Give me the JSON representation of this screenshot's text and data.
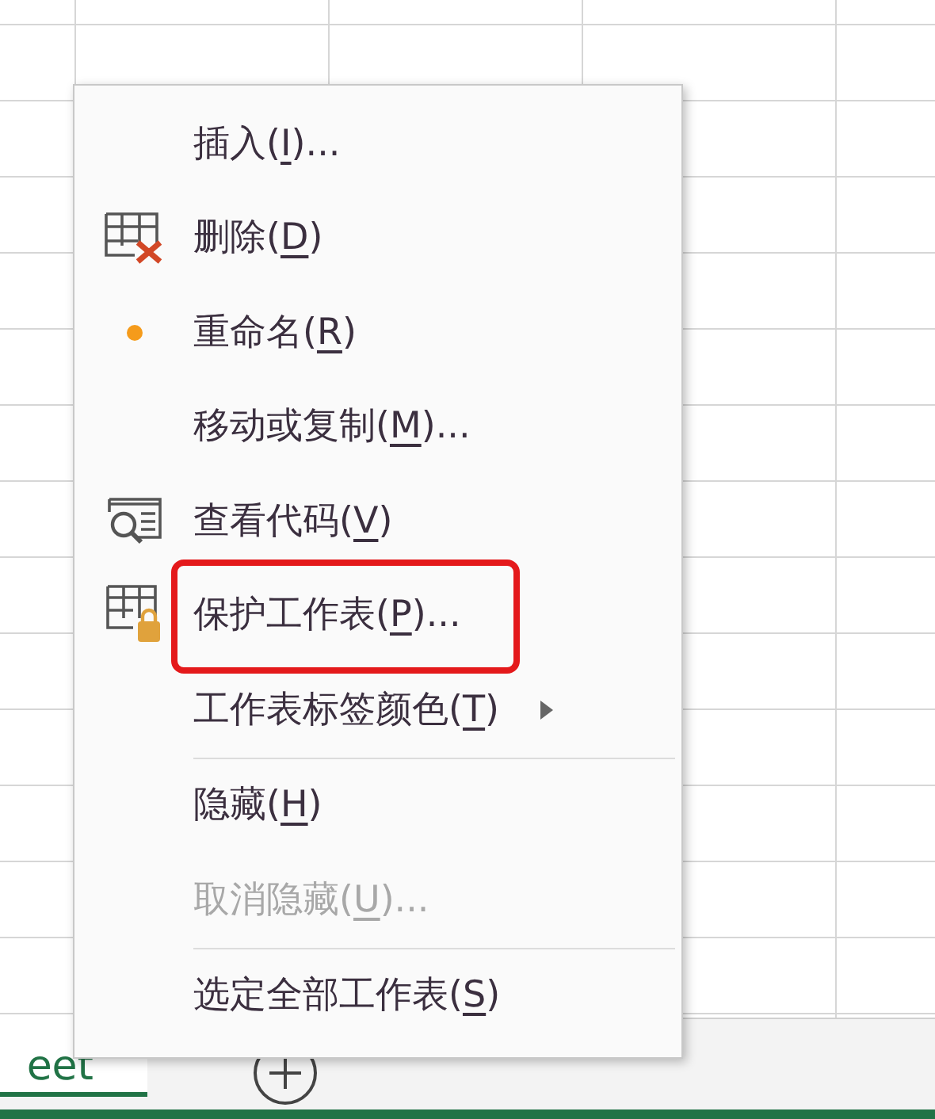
{
  "sheet_tabs": [
    {
      "label": "eet",
      "selected": true
    }
  ],
  "context_menu": {
    "items": [
      {
        "label": "插入(",
        "key": "I",
        "suffix": ")...",
        "kind": "plain",
        "disabled": false,
        "submenu": false,
        "separator_before": false,
        "highlighted": false
      },
      {
        "label": "删除(",
        "key": "D",
        "suffix": ")",
        "kind": "delete",
        "disabled": false,
        "submenu": false,
        "separator_before": false,
        "highlighted": false
      },
      {
        "label": "重命名(",
        "key": "R",
        "suffix": ")",
        "kind": "bullet",
        "disabled": false,
        "submenu": false,
        "separator_before": false,
        "highlighted": false
      },
      {
        "label": "移动或复制(",
        "key": "M",
        "suffix": ")...",
        "kind": "plain",
        "disabled": false,
        "submenu": false,
        "separator_before": false,
        "highlighted": false
      },
      {
        "label": "查看代码(",
        "key": "V",
        "suffix": ")",
        "kind": "code",
        "disabled": false,
        "submenu": false,
        "separator_before": false,
        "highlighted": false
      },
      {
        "label": "保护工作表(",
        "key": "P",
        "suffix": ")...",
        "kind": "protect",
        "disabled": false,
        "submenu": false,
        "separator_before": false,
        "highlighted": true
      },
      {
        "label": "工作表标签颜色(",
        "key": "T",
        "suffix": ")",
        "kind": "plain",
        "disabled": false,
        "submenu": true,
        "separator_before": false,
        "highlighted": false
      },
      {
        "label": "隐藏(",
        "key": "H",
        "suffix": ")",
        "kind": "plain",
        "disabled": false,
        "submenu": false,
        "separator_before": true,
        "highlighted": false
      },
      {
        "label": "取消隐藏(",
        "key": "U",
        "suffix": ")...",
        "kind": "plain",
        "disabled": true,
        "submenu": false,
        "separator_before": false,
        "highlighted": false
      },
      {
        "label": "选定全部工作表(",
        "key": "S",
        "suffix": ")",
        "kind": "plain",
        "disabled": false,
        "submenu": false,
        "separator_before": true,
        "highlighted": false
      }
    ]
  }
}
